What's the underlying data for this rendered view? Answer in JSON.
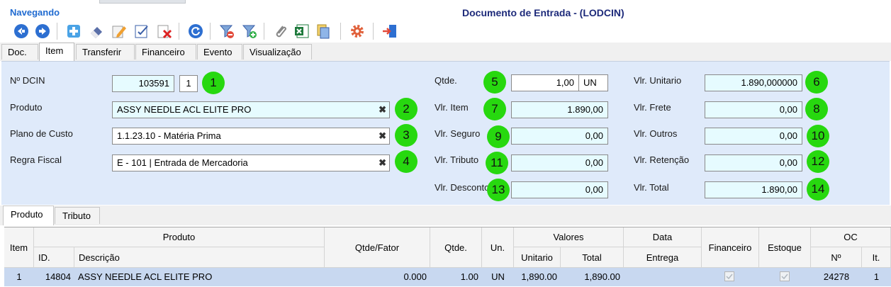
{
  "header": {
    "nav_label": "Navegando",
    "title": "Documento de Entrada - (LODCIN)"
  },
  "toolbar": {
    "icons": [
      "back-arrow-icon",
      "forward-arrow-icon",
      "add-icon",
      "eraser-icon",
      "edit-pencil-icon",
      "edit-check-icon",
      "delete-icon",
      "refresh-icon",
      "filter-remove-icon",
      "filter-add-icon",
      "attach-icon",
      "excel-icon",
      "copy-documents-icon",
      "settings-gear-icon",
      "exit-door-icon"
    ]
  },
  "tabs_top": [
    "Doc.",
    "Item",
    "Transferir",
    "Financeiro",
    "Evento",
    "Visualização"
  ],
  "active_tab": "Item",
  "form": {
    "n_dcin_label": "Nº DCIN",
    "n_dcin_value": "103591",
    "n_dcin_seq": "1",
    "produto_label": "Produto",
    "produto_value": "ASSY NEEDLE ACL ELITE PRO",
    "plano_label": "Plano de Custo",
    "plano_value": "1.1.23.10 - Matéria Prima",
    "regra_label": "Regra Fiscal",
    "regra_value": "E - 101 | Entrada de Mercadoria",
    "qtde_label": "Qtde.",
    "qtde_value": "1,00",
    "qtde_unit": "UN",
    "vlr_item_label": "Vlr. Item",
    "vlr_item_value": "1.890,00",
    "vlr_seguro_label": "Vlr. Seguro",
    "vlr_seguro_value": "0,00",
    "vlr_tributo_label": "Vlr. Tributo",
    "vlr_tributo_value": "0,00",
    "vlr_desconto_label": "Vlr. Desconto",
    "vlr_desconto_value": "0,00",
    "vlr_unitario_label": "Vlr. Unitario",
    "vlr_unitario_value": "1.890,000000",
    "vlr_frete_label": "Vlr. Frete",
    "vlr_frete_value": "0,00",
    "vlr_outros_label": "Vlr. Outros",
    "vlr_outros_value": "0,00",
    "vlr_retencao_label": "Vlr. Retenção",
    "vlr_retencao_value": "0,00",
    "vlr_total_label": "Vlr. Total",
    "vlr_total_value": "1.890,00",
    "clear_symbol": "✖"
  },
  "markers": [
    "1",
    "2",
    "3",
    "4",
    "5",
    "6",
    "7",
    "8",
    "9",
    "10",
    "11",
    "12",
    "13",
    "14"
  ],
  "tabs_bottom": [
    "Produto",
    "Tributo"
  ],
  "grid": {
    "headers": {
      "item": "Item",
      "produto": "Produto",
      "id": "ID.",
      "descricao": "Descrição",
      "qtde_fator": "Qtde/Fator",
      "qtde": "Qtde.",
      "un": "Un.",
      "valores": "Valores",
      "unitario": "Unitario",
      "total": "Total",
      "data": "Data",
      "entrega": "Entrega",
      "financeiro": "Financeiro",
      "estoque": "Estoque",
      "oc": "OC",
      "oc_n": "Nº",
      "oc_it": "It."
    },
    "rows": [
      {
        "item": "1",
        "id": "14804",
        "descricao": "ASSY NEEDLE ACL ELITE PRO",
        "qtde_fator": "0.000",
        "qtde": "1.00",
        "un": "UN",
        "unitario": "1,890.00",
        "total": "1,890.00",
        "entrega": "",
        "oc_n": "24278",
        "oc_it": "1"
      }
    ]
  },
  "colors": {
    "nav": "#1f6ad0",
    "title": "#1d2a7a",
    "panel_bg": "#dfeafa",
    "field_bg": "#e6fbff",
    "marker": "#27d80f",
    "row_selected": "#c8d8f0"
  }
}
